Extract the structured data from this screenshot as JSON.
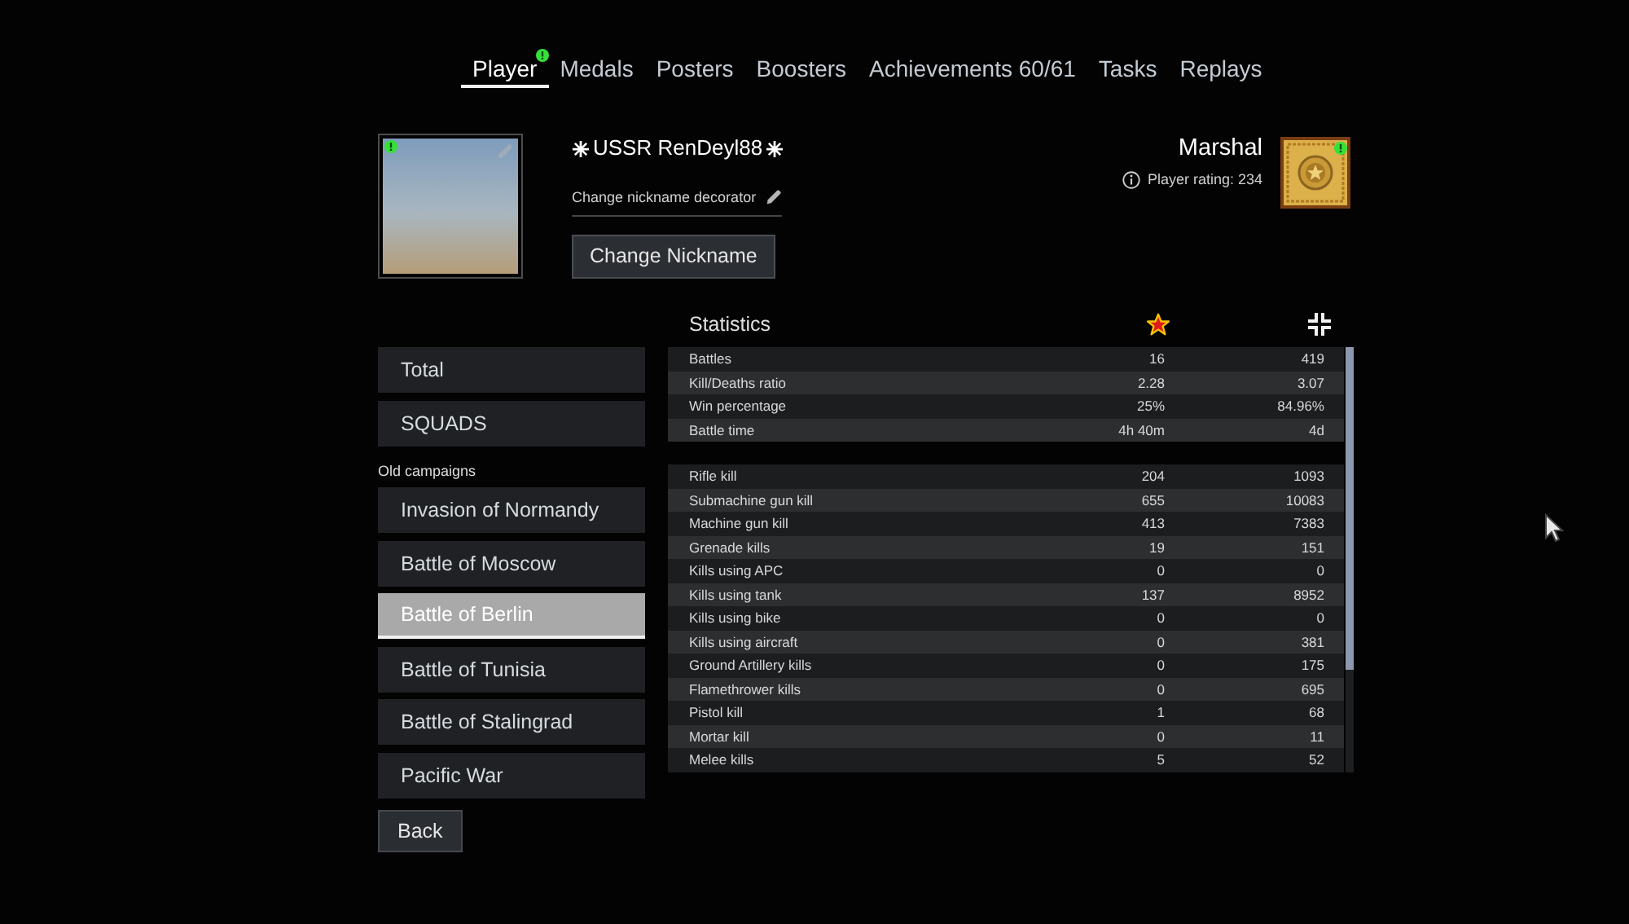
{
  "tabs": [
    {
      "label": "Player",
      "selected": true,
      "badge": true
    },
    {
      "label": "Medals",
      "selected": false,
      "badge": false
    },
    {
      "label": "Posters",
      "selected": false,
      "badge": false
    },
    {
      "label": "Boosters",
      "selected": false,
      "badge": false
    },
    {
      "label": "Achievements 60/61",
      "selected": false,
      "badge": false
    },
    {
      "label": "Tasks",
      "selected": false,
      "badge": false
    },
    {
      "label": "Replays",
      "selected": false,
      "badge": false
    }
  ],
  "profile": {
    "avatar_badge": true,
    "nickname": "USSR RenDeyl88",
    "decorator_link": "Change nickname decorator",
    "change_nickname_button": "Change Nickname",
    "rank": "Marshal",
    "rating": "Player rating: 234",
    "rank_badge": true
  },
  "sidebar": {
    "items": [
      {
        "label": "Total",
        "selected": false
      },
      {
        "label": "SQUADS",
        "selected": false
      }
    ],
    "groups": [
      {
        "title": "Old campaigns",
        "items": [
          {
            "label": "Invasion of Normandy",
            "selected": false
          },
          {
            "label": "Battle of Moscow",
            "selected": false
          },
          {
            "label": "Battle of Berlin",
            "selected": true
          },
          {
            "label": "Battle of Tunisia",
            "selected": false
          },
          {
            "label": "Battle of Stalingrad",
            "selected": false
          },
          {
            "label": "Pacific War",
            "selected": false
          }
        ]
      }
    ],
    "back_button": "Back"
  },
  "statistics": {
    "title": "Statistics",
    "groups": [
      {
        "rows": [
          {
            "label": "Battles",
            "values": [
              "16",
              "419"
            ]
          },
          {
            "label": "Kill/Deaths ratio",
            "values": [
              "2.28",
              "3.07"
            ]
          },
          {
            "label": "Win percentage",
            "values": [
              "25%",
              "84.96%"
            ]
          },
          {
            "label": "Battle time",
            "values": [
              "4h 40m",
              "4d"
            ]
          }
        ]
      },
      {
        "rows": [
          {
            "label": "Rifle kill",
            "values": [
              "204",
              "1093"
            ]
          },
          {
            "label": "Submachine gun kill",
            "values": [
              "655",
              "10083"
            ]
          },
          {
            "label": "Machine gun kill",
            "values": [
              "413",
              "7383"
            ]
          },
          {
            "label": "Grenade kills",
            "values": [
              "19",
              "151"
            ]
          },
          {
            "label": "Kills using APC",
            "values": [
              "0",
              "0"
            ]
          },
          {
            "label": "Kills using tank",
            "values": [
              "137",
              "8952"
            ]
          },
          {
            "label": "Kills using bike",
            "values": [
              "0",
              "0"
            ]
          },
          {
            "label": "Kills using aircraft",
            "values": [
              "0",
              "381"
            ]
          },
          {
            "label": "Ground Artillery kills",
            "values": [
              "0",
              "175"
            ]
          },
          {
            "label": "Flamethrower kills",
            "values": [
              "0",
              "695"
            ]
          },
          {
            "label": "Pistol kill",
            "values": [
              "1",
              "68"
            ]
          },
          {
            "label": "Mortar kill",
            "values": [
              "0",
              "11"
            ]
          },
          {
            "label": "Melee kills",
            "values": [
              "5",
              "52"
            ]
          }
        ]
      }
    ]
  }
}
